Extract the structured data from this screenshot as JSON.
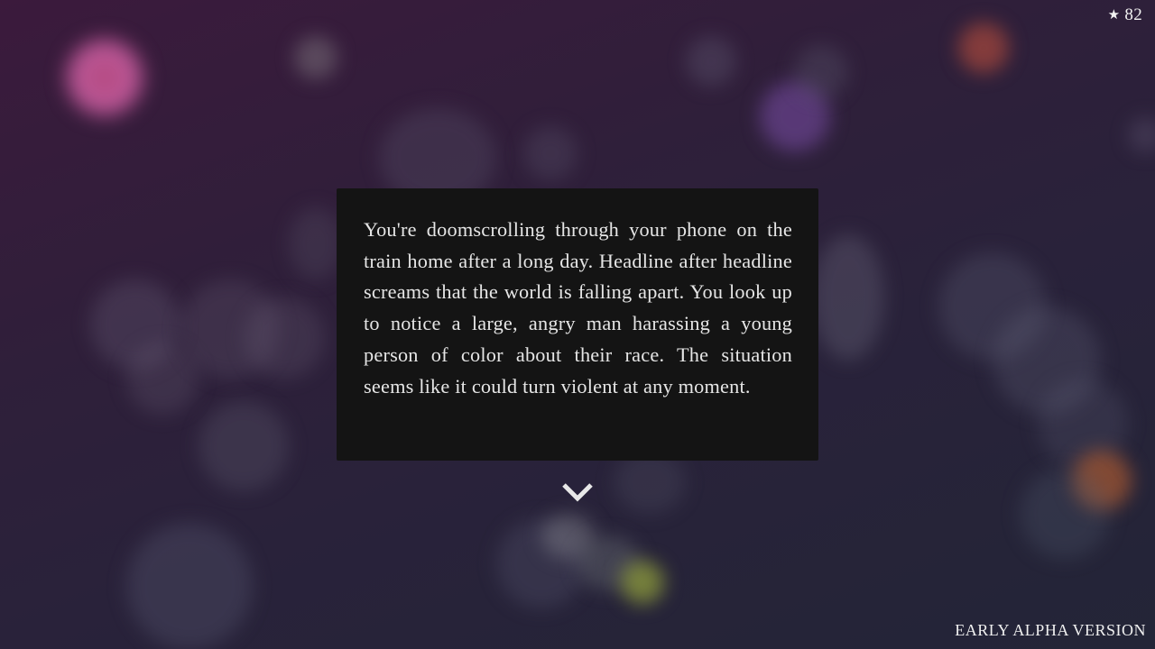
{
  "hud": {
    "score_icon": "star-icon",
    "score": "82"
  },
  "story": {
    "text": "You're doomscrolling through your phone on the train home after a long day. Headline after headline screams that the world is falling apart. You look up to notice a large, angry man harassing a young person of color about their race. The situation seems like it could turn violent at any moment.",
    "continue_icon": "chevron-down-icon"
  },
  "footer": {
    "version_label": "EARLY ALPHA VERSION"
  },
  "colors": {
    "dialog_background": "#141414",
    "dialog_text": "#e6e6e6",
    "background_top": "#3b1a3c",
    "background_bottom": "#232537"
  }
}
